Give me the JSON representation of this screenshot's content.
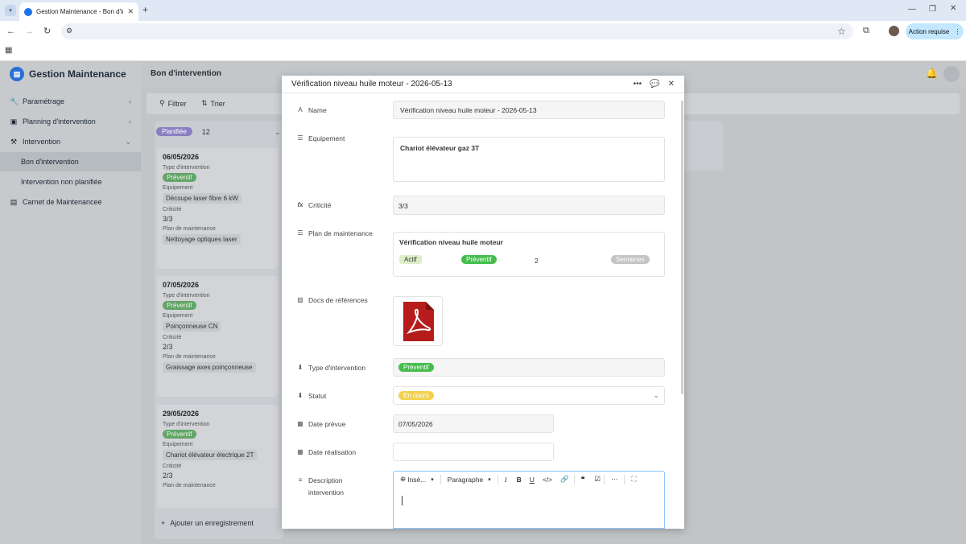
{
  "browser": {
    "tab_title": "Gestion Maintenance - Bon d'in",
    "action_required": "Action requise"
  },
  "app": {
    "name": "Gestion Maintenance",
    "page_title": "Bon d'intervention"
  },
  "sidebar": {
    "items": [
      {
        "label": "Paramétrage",
        "icon": "wrench-icon"
      },
      {
        "label": "Planning d'intervention",
        "icon": "calendar-icon"
      },
      {
        "label": "Intervention",
        "icon": "hammer-icon"
      },
      {
        "label": "Bon d'intervention",
        "icon": ""
      },
      {
        "label": "Intervention non planifiée",
        "icon": ""
      },
      {
        "label": "Carnet de Maintenancee",
        "icon": "book-icon"
      }
    ]
  },
  "viewbar": {
    "filter": "Filtrer",
    "sort": "Trier"
  },
  "kanban": {
    "column": {
      "status": "Planifiée",
      "count": "12"
    },
    "cards": [
      {
        "date": "06/05/2026",
        "type_label": "Type d'intervention",
        "type": "Préventif",
        "equip_label": "Equipement",
        "equip": "Découpe laser fibre 6 kW",
        "crit_label": "Criticité",
        "crit": "3/3",
        "plan_label": "Plan de maintenance",
        "plan": "Nettoyage optiques laser"
      },
      {
        "date": "07/05/2026",
        "type_label": "Type d'intervention",
        "type": "Préventif",
        "equip_label": "Equipement",
        "equip": "Poinçonneuse CN",
        "crit_label": "Criticité",
        "crit": "2/3",
        "plan_label": "Plan de maintenance",
        "plan": "Graissage axes poinçonneuse"
      },
      {
        "date": "29/05/2026",
        "type_label": "Type d'intervention",
        "type": "Préventif",
        "equip_label": "Equipement",
        "equip": "Chariot élévateur électrique 2T",
        "crit_label": "Criticité",
        "crit": "2/3",
        "plan_label": "Plan de maintenance",
        "plan": ""
      }
    ],
    "add_record": "Ajouter un enregistrement"
  },
  "modal": {
    "title": "Vérification niveau huile moteur - 2026-05-13",
    "fields": {
      "name_label": "Name",
      "name_value": "Vérification niveau huile moteur - 2026-05-13",
      "equip_label": "Equipement",
      "equip_value": "Chariot élévateur gaz 3T",
      "crit_label": "Criticité",
      "crit_value": "3/3",
      "plan_label": "Plan de maintenance",
      "plan_title": "Vérification niveau huile moteur",
      "plan_status": "Actif",
      "plan_type": "Préventif",
      "plan_freq": "2",
      "plan_unit": "Semaines",
      "docs_label": "Docs de références",
      "type_label": "Type d'intervention",
      "type_value": "Préventif",
      "statut_label": "Statut",
      "statut_value": "En cours",
      "date_prevue_label": "Date prévue",
      "date_prevue_value": "07/05/2026",
      "date_real_label": "Date réalisation",
      "date_real_value": "",
      "desc_label_1": "Description",
      "desc_label_2": "intervention"
    },
    "editor": {
      "insert": "Insé...",
      "paragraph": "Paragraphe"
    }
  },
  "colors": {
    "preventif": "#44bd4c",
    "en_cours": "#f4d24e",
    "planifiee": "#8a7fc0",
    "accent": "#2a6fd6"
  }
}
